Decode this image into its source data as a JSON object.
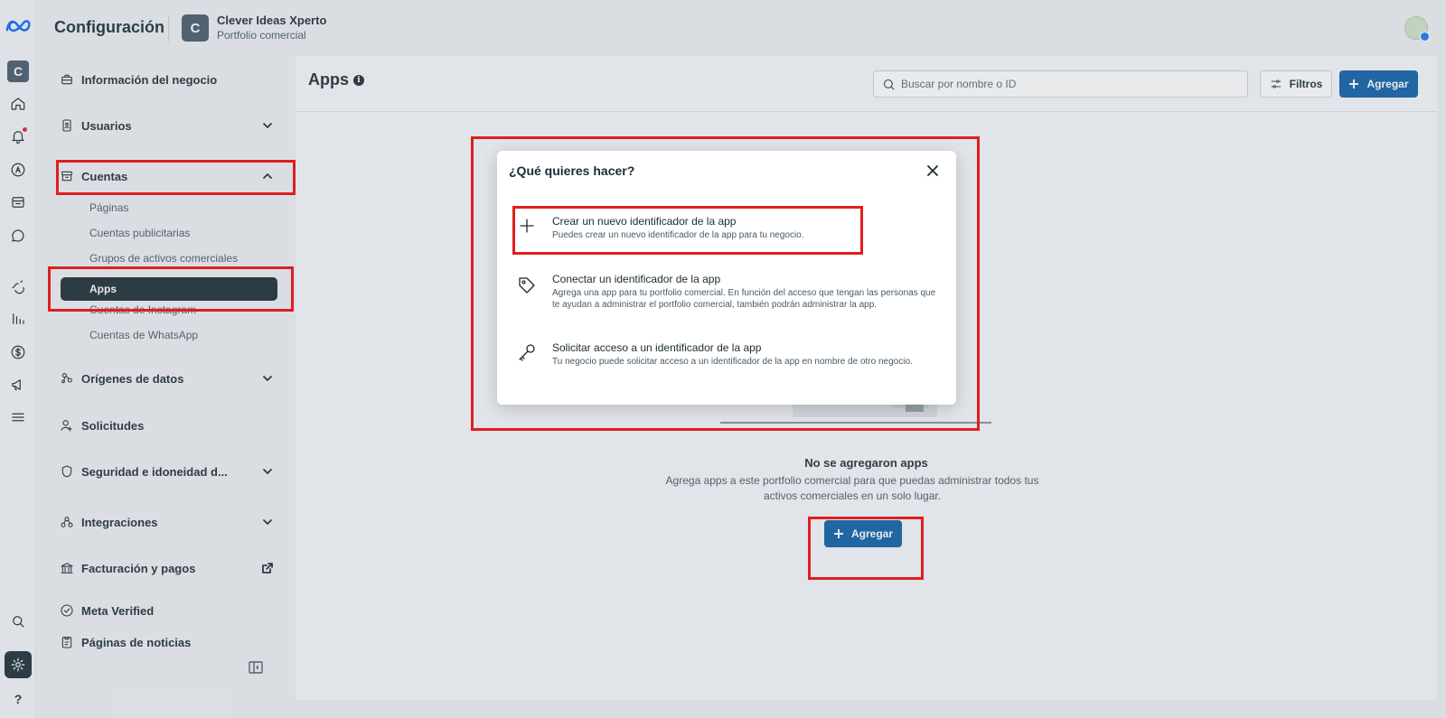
{
  "header": {
    "section_title": "Configuración",
    "business_initial": "C",
    "business_name": "Clever Ideas Xperto",
    "business_type": "Portfolio comercial"
  },
  "rail": {
    "account_initial": "C",
    "help": "?"
  },
  "nav": {
    "business_info": "Información del negocio",
    "users": "Usuarios",
    "accounts": "Cuentas",
    "accounts_sub": [
      "Páginas",
      "Cuentas publicitarias",
      "Grupos de activos comerciales",
      "Apps",
      "Cuentas de Instagram",
      "Cuentas de WhatsApp"
    ],
    "data_sources": "Orígenes de datos",
    "requests": "Solicitudes",
    "security": "Seguridad e idoneidad d...",
    "integrations": "Integraciones",
    "billing": "Facturación y pagos",
    "meta_verified": "Meta Verified",
    "news_pages": "Páginas de noticias"
  },
  "main": {
    "title": "Apps",
    "info": "i",
    "search_placeholder": "Buscar por nombre o ID",
    "filters": "Filtros",
    "add": "Agregar",
    "empty_title": "No se agregaron apps",
    "empty_desc": "Agrega apps a este portfolio comercial para que puedas administrar todos tus activos comerciales en un solo lugar.",
    "empty_add": "Agregar"
  },
  "modal": {
    "title": "¿Qué quieres hacer?",
    "options": [
      {
        "title": "Crear un nuevo identificador de la app",
        "desc": "Puedes crear un nuevo identificador de la app para tu negocio.",
        "icon": "plus-icon"
      },
      {
        "title": "Conectar un identificador de la app",
        "desc": "Agrega una app para tu portfolio comercial. En función del acceso que tengan las personas que te ayudan a administrar el portfolio comercial, también podrán administrar la app.",
        "icon": "tag-icon"
      },
      {
        "title": "Solicitar acceso a un identificador de la app",
        "desc": "Tu negocio puede solicitar acceso a un identificador de la app en nombre de otro negocio.",
        "icon": "key-icon"
      }
    ]
  },
  "colors": {
    "primary": "#0b5fa5",
    "dark": "#1c2b33",
    "highlight": "#e01e1e"
  }
}
